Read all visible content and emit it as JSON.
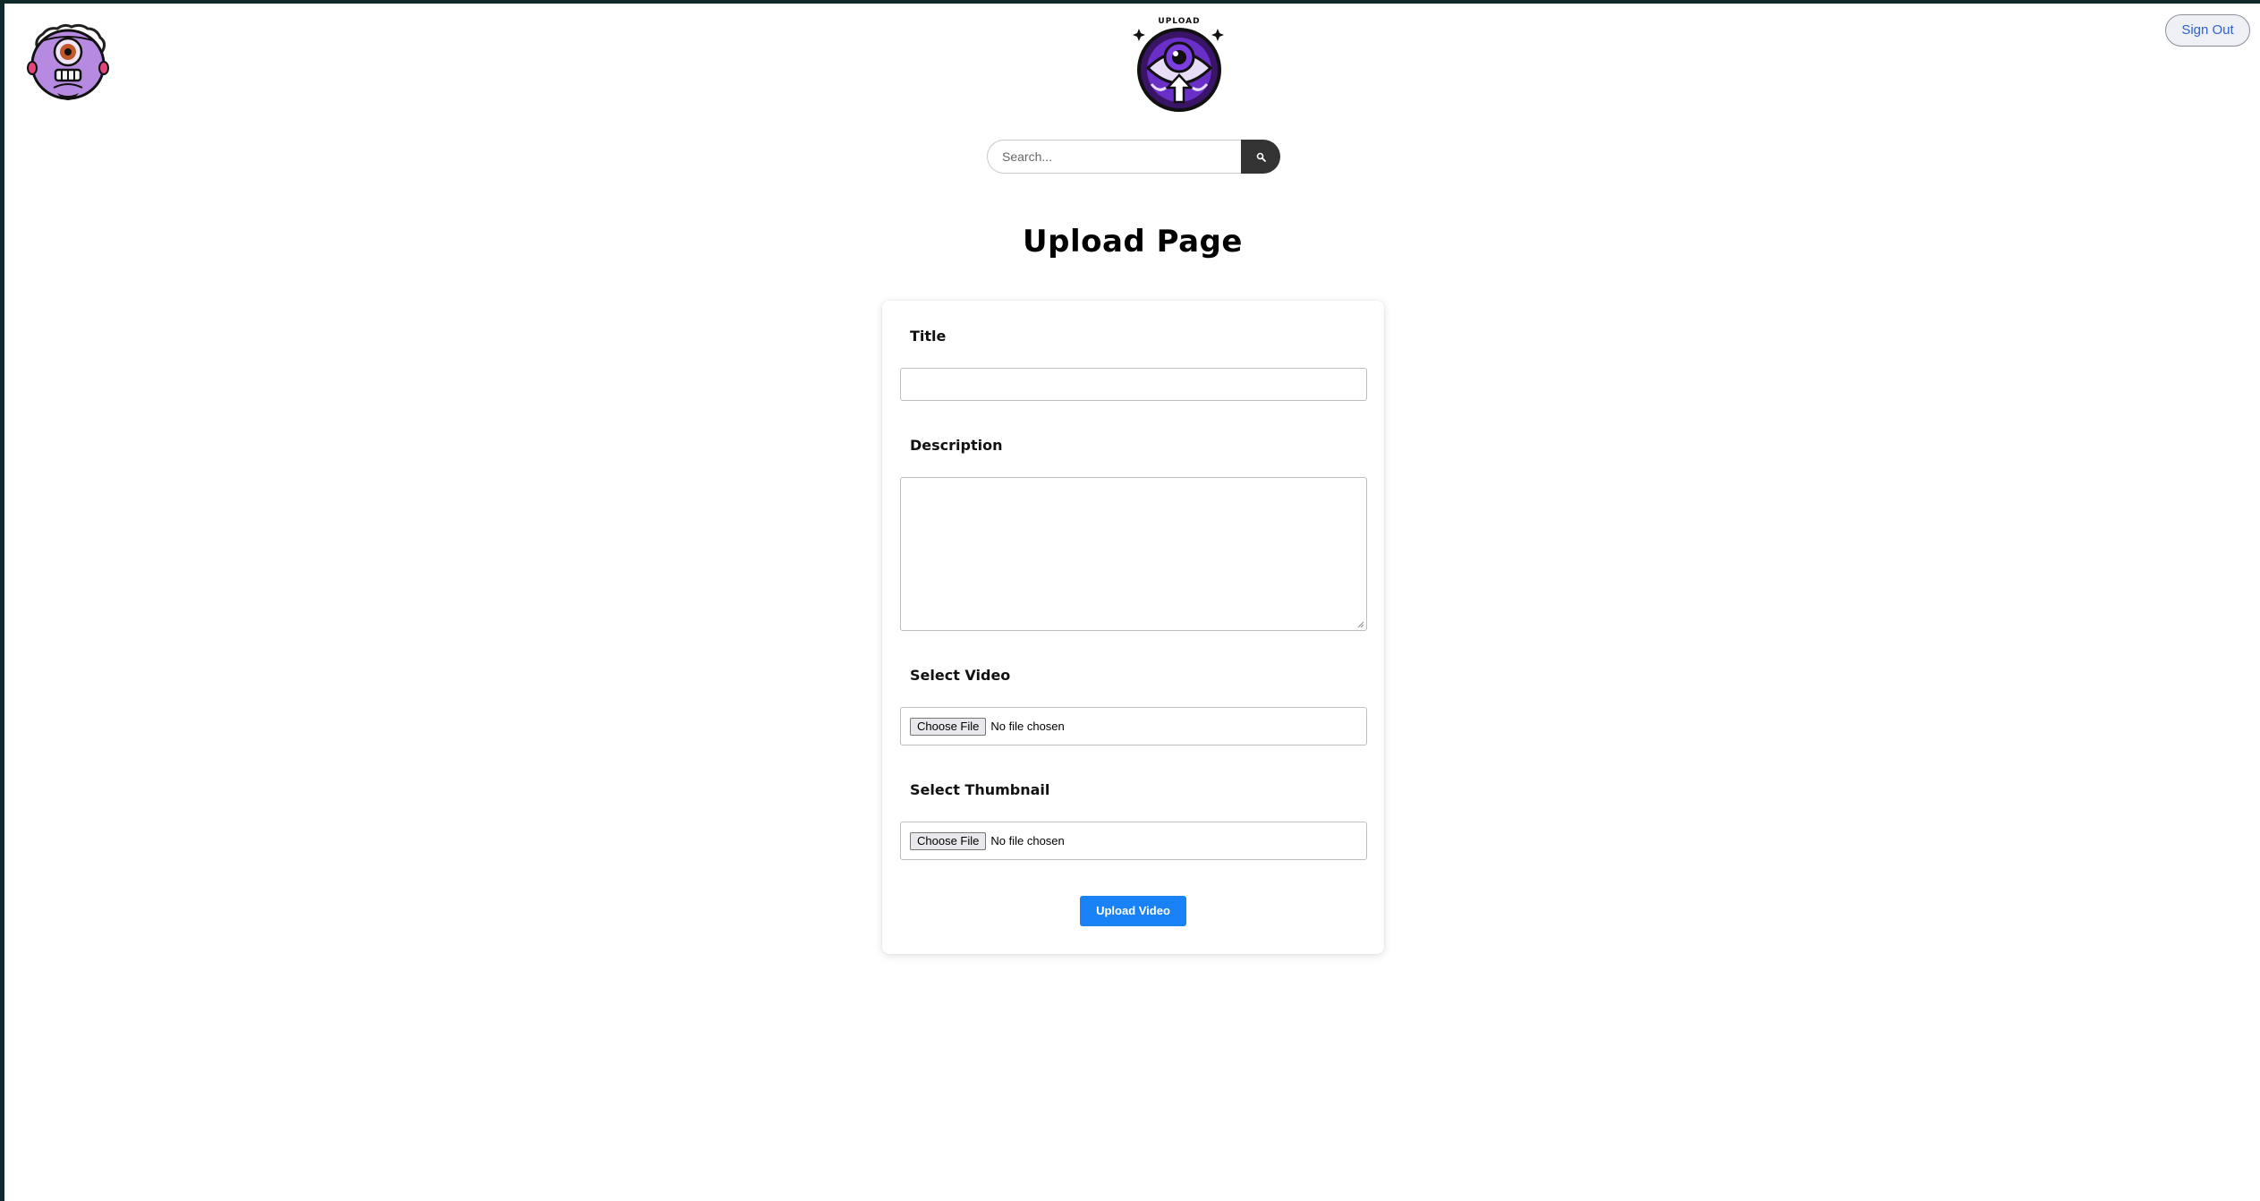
{
  "header": {
    "signout_label": "Sign Out",
    "logo_text": "UPLOAD"
  },
  "search": {
    "placeholder": "Search..."
  },
  "page": {
    "title": "Upload Page"
  },
  "form": {
    "title_label": "Title",
    "description_label": "Description",
    "video_label": "Select Video",
    "thumbnail_label": "Select Thumbnail",
    "choose_file_label": "Choose File",
    "no_file_text": "No file chosen",
    "submit_label": "Upload Video"
  },
  "colors": {
    "primary_button": "#1a82f7",
    "search_button": "#333333",
    "avatar_purple": "#b58ae0",
    "logo_purple": "#6a2fc7"
  },
  "icons": {
    "avatar": "cyclops-avatar-icon",
    "logo": "eye-upload-logo-icon",
    "search": "search-icon"
  }
}
